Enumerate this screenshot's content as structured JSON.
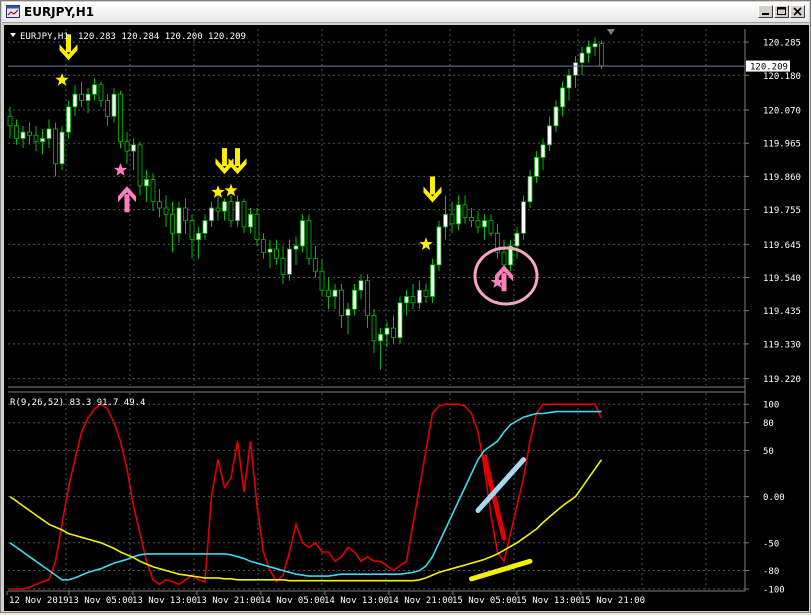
{
  "window": {
    "title": "EURJPY,H1"
  },
  "price_pane": {
    "header_symbol": "EURJPY,H1",
    "header_ohlc": "120.283 120.284 120.200 120.209",
    "current_price_label": "120.209",
    "y_ticks": [
      "120.285",
      "120.180",
      "120.070",
      "119.965",
      "119.860",
      "119.755",
      "119.645",
      "119.540",
      "119.435",
      "119.330",
      "119.220"
    ]
  },
  "indicator_pane": {
    "header": "R(9,26,52) 83.3 91.7 49.4",
    "y_ticks": [
      "100",
      "80",
      "50",
      "0.00",
      "-50",
      "-80",
      "-100"
    ]
  },
  "x_ticks": [
    "12 Nov 2019",
    "13 Nov 05:00",
    "13 Nov 13:00",
    "13 Nov 21:00",
    "14 Nov 05:00",
    "14 Nov 13:00",
    "14 Nov 21:00",
    "15 Nov 05:00",
    "15 Nov 13:00",
    "15 Nov 21:00"
  ],
  "colors": {
    "background": "#000000",
    "grid": "#4a5a5a",
    "bull_candle": "#ffffff",
    "bear_candle": "#000000",
    "candle_wick": "#00c000",
    "signal_yellow": "#ffee00",
    "signal_pink": "#ff7fbf",
    "line_red": "#e00000",
    "line_cyan": "#40d8f0",
    "line_yellow": "#f0f000"
  },
  "chart_data": [
    {
      "type": "candlestick",
      "ylim": [
        119.2,
        120.32
      ],
      "candles": [
        [
          120.05,
          120.08,
          119.98,
          120.02
        ],
        [
          120.02,
          120.04,
          119.96,
          119.98
        ],
        [
          119.98,
          120.02,
          119.95,
          120.0
        ],
        [
          120.0,
          120.03,
          119.96,
          119.99
        ],
        [
          119.99,
          120.02,
          119.94,
          119.97
        ],
        [
          119.97,
          120.01,
          119.93,
          119.98
        ],
        [
          119.98,
          120.04,
          119.95,
          120.01
        ],
        [
          120.01,
          120.03,
          119.86,
          119.9
        ],
        [
          119.9,
          120.02,
          119.88,
          120.0
        ],
        [
          120.0,
          120.1,
          119.98,
          120.08
        ],
        [
          120.08,
          120.15,
          120.05,
          120.12
        ],
        [
          120.12,
          120.16,
          120.08,
          120.1
        ],
        [
          120.1,
          120.14,
          120.06,
          120.12
        ],
        [
          120.12,
          120.17,
          120.1,
          120.15
        ],
        [
          120.15,
          120.16,
          120.08,
          120.1
        ],
        [
          120.1,
          120.12,
          120.02,
          120.05
        ],
        [
          120.05,
          120.14,
          120.03,
          120.12
        ],
        [
          120.12,
          120.13,
          119.95,
          119.97
        ],
        [
          119.97,
          120.0,
          119.9,
          119.94
        ],
        [
          119.94,
          119.98,
          119.88,
          119.96
        ],
        [
          119.96,
          119.97,
          119.8,
          119.83
        ],
        [
          119.83,
          119.88,
          119.78,
          119.85
        ],
        [
          119.85,
          119.87,
          119.75,
          119.78
        ],
        [
          119.78,
          119.82,
          119.73,
          119.76
        ],
        [
          119.76,
          119.8,
          119.7,
          119.74
        ],
        [
          119.74,
          119.78,
          119.62,
          119.68
        ],
        [
          119.68,
          119.78,
          119.65,
          119.76
        ],
        [
          119.76,
          119.79,
          119.68,
          119.72
        ],
        [
          119.72,
          119.74,
          119.6,
          119.66
        ],
        [
          119.66,
          119.7,
          119.6,
          119.68
        ],
        [
          119.68,
          119.74,
          119.66,
          119.72
        ],
        [
          119.72,
          119.78,
          119.7,
          119.76
        ],
        [
          119.76,
          119.8,
          119.72,
          119.75
        ],
        [
          119.75,
          119.79,
          119.72,
          119.78
        ],
        [
          119.78,
          119.8,
          119.7,
          119.72
        ],
        [
          119.72,
          119.8,
          119.7,
          119.78
        ],
        [
          119.78,
          119.79,
          119.68,
          119.7
        ],
        [
          119.7,
          119.76,
          119.68,
          119.74
        ],
        [
          119.74,
          119.76,
          119.64,
          119.66
        ],
        [
          119.66,
          119.68,
          119.6,
          119.62
        ],
        [
          119.62,
          119.66,
          119.57,
          119.63
        ],
        [
          119.63,
          119.66,
          119.58,
          119.6
        ],
        [
          119.6,
          119.64,
          119.52,
          119.55
        ],
        [
          119.55,
          119.66,
          119.53,
          119.63
        ],
        [
          119.63,
          119.67,
          119.58,
          119.64
        ],
        [
          119.64,
          119.74,
          119.62,
          119.72
        ],
        [
          119.72,
          119.74,
          119.58,
          119.6
        ],
        [
          119.6,
          119.64,
          119.54,
          119.56
        ],
        [
          119.56,
          119.6,
          119.48,
          119.5
        ],
        [
          119.5,
          119.54,
          119.44,
          119.48
        ],
        [
          119.48,
          119.52,
          119.44,
          119.5
        ],
        [
          119.5,
          119.52,
          119.38,
          119.42
        ],
        [
          119.42,
          119.46,
          119.36,
          119.44
        ],
        [
          119.44,
          119.52,
          119.42,
          119.5
        ],
        [
          119.5,
          119.55,
          119.47,
          119.53
        ],
        [
          119.53,
          119.55,
          119.38,
          119.42
        ],
        [
          119.42,
          119.44,
          119.3,
          119.34
        ],
        [
          119.34,
          119.38,
          119.25,
          119.36
        ],
        [
          119.36,
          119.4,
          119.32,
          119.38
        ],
        [
          119.38,
          119.42,
          119.33,
          119.35
        ],
        [
          119.35,
          119.48,
          119.33,
          119.46
        ],
        [
          119.46,
          119.5,
          119.42,
          119.48
        ],
        [
          119.48,
          119.52,
          119.44,
          119.46
        ],
        [
          119.46,
          119.53,
          119.44,
          119.5
        ],
        [
          119.5,
          119.52,
          119.46,
          119.48
        ],
        [
          119.48,
          119.6,
          119.46,
          119.58
        ],
        [
          119.58,
          119.72,
          119.56,
          119.7
        ],
        [
          119.7,
          119.8,
          119.66,
          119.74
        ],
        [
          119.74,
          119.78,
          119.68,
          119.71
        ],
        [
          119.71,
          119.8,
          119.69,
          119.77
        ],
        [
          119.77,
          119.8,
          119.71,
          119.73
        ],
        [
          119.73,
          119.76,
          119.7,
          119.72
        ],
        [
          119.72,
          119.75,
          119.68,
          119.7
        ],
        [
          119.7,
          119.74,
          119.66,
          119.72
        ],
        [
          119.72,
          119.74,
          119.67,
          119.68
        ],
        [
          119.68,
          119.71,
          119.6,
          119.62
        ],
        [
          119.62,
          119.66,
          119.54,
          119.58
        ],
        [
          119.58,
          119.66,
          119.56,
          119.64
        ],
        [
          119.64,
          119.7,
          119.6,
          119.68
        ],
        [
          119.68,
          119.8,
          119.66,
          119.78
        ],
        [
          119.78,
          119.88,
          119.76,
          119.86
        ],
        [
          119.86,
          119.94,
          119.84,
          119.92
        ],
        [
          119.92,
          119.98,
          119.88,
          119.96
        ],
        [
          119.96,
          120.05,
          119.94,
          120.02
        ],
        [
          120.02,
          120.1,
          120.0,
          120.08
        ],
        [
          120.08,
          120.16,
          120.05,
          120.14
        ],
        [
          120.14,
          120.2,
          120.1,
          120.18
        ],
        [
          120.18,
          120.24,
          120.14,
          120.22
        ],
        [
          120.22,
          120.27,
          120.18,
          120.25
        ],
        [
          120.25,
          120.29,
          120.22,
          120.27
        ],
        [
          120.27,
          120.3,
          120.24,
          120.28
        ],
        [
          120.28,
          120.29,
          120.2,
          120.21
        ]
      ],
      "signals": [
        {
          "kind": "arrow-down",
          "color": "yellow",
          "index": 9,
          "price": 120.24
        },
        {
          "kind": "star",
          "color": "yellow",
          "index": 8,
          "price": 120.165
        },
        {
          "kind": "star",
          "color": "pink",
          "index": 17,
          "price": 119.88
        },
        {
          "kind": "arrow-up",
          "color": "pink",
          "index": 18,
          "price": 119.81
        },
        {
          "kind": "arrow-down",
          "color": "yellow",
          "index": 33,
          "price": 119.88
        },
        {
          "kind": "arrow-down",
          "color": "yellow",
          "index": 35,
          "price": 119.88
        },
        {
          "kind": "star",
          "color": "yellow",
          "index": 32,
          "price": 119.81
        },
        {
          "kind": "star",
          "color": "yellow",
          "index": 34,
          "price": 119.815
        },
        {
          "kind": "arrow-down",
          "color": "yellow",
          "index": 65,
          "price": 119.79
        },
        {
          "kind": "star",
          "color": "yellow",
          "index": 64,
          "price": 119.645
        },
        {
          "kind": "star",
          "color": "pink",
          "index": 75,
          "price": 119.525
        },
        {
          "kind": "arrow-up",
          "color": "pink",
          "index": 76,
          "price": 119.56
        }
      ],
      "circle_highlight": {
        "index": 76,
        "price": 119.545
      }
    },
    {
      "type": "line",
      "ylim": [
        -100,
        110
      ],
      "series": [
        {
          "color": "red",
          "values": [
            -100,
            -100,
            -100,
            -98,
            -95,
            -92,
            -90,
            -70,
            -30,
            10,
            40,
            70,
            85,
            95,
            100,
            95,
            80,
            60,
            30,
            -10,
            -40,
            -70,
            -90,
            -95,
            -90,
            -92,
            -95,
            -90,
            -85,
            -90,
            -92,
            0,
            40,
            10,
            20,
            60,
            5,
            60,
            -10,
            -60,
            -80,
            -92,
            -85,
            -60,
            -30,
            -50,
            -55,
            -50,
            -60,
            -60,
            -70,
            -65,
            -55,
            -60,
            -70,
            -65,
            -70,
            -70,
            -75,
            -80,
            -75,
            -70,
            -30,
            10,
            50,
            90,
            98,
            100,
            100,
            100,
            98,
            90,
            70,
            30,
            -20,
            -60,
            -70,
            -40,
            -10,
            20,
            60,
            90,
            100,
            100,
            100,
            100,
            100,
            100,
            100,
            100,
            100,
            85
          ]
        },
        {
          "color": "cyan",
          "values": [
            -50,
            -55,
            -60,
            -65,
            -70,
            -75,
            -80,
            -85,
            -90,
            -90,
            -88,
            -85,
            -82,
            -80,
            -78,
            -75,
            -72,
            -70,
            -68,
            -65,
            -63,
            -62,
            -62,
            -62,
            -62,
            -62,
            -62,
            -62,
            -62,
            -62,
            -62,
            -62,
            -62,
            -62,
            -63,
            -65,
            -67,
            -70,
            -72,
            -74,
            -76,
            -78,
            -80,
            -82,
            -84,
            -85,
            -86,
            -86,
            -86,
            -86,
            -85,
            -84,
            -84,
            -84,
            -84,
            -84,
            -84,
            -84,
            -84,
            -84,
            -84,
            -83,
            -82,
            -80,
            -75,
            -65,
            -50,
            -35,
            -20,
            -5,
            10,
            25,
            40,
            50,
            55,
            60,
            70,
            78,
            82,
            86,
            88,
            90,
            90,
            91,
            92,
            92,
            92,
            92,
            92,
            92,
            92,
            92
          ]
        },
        {
          "color": "yellow",
          "values": [
            0,
            -5,
            -10,
            -15,
            -20,
            -25,
            -30,
            -33,
            -36,
            -40,
            -42,
            -44,
            -46,
            -48,
            -50,
            -53,
            -56,
            -60,
            -63,
            -66,
            -70,
            -73,
            -76,
            -78,
            -80,
            -82,
            -84,
            -85,
            -86,
            -87,
            -88,
            -88,
            -88,
            -89,
            -89,
            -90,
            -90,
            -90,
            -90,
            -90,
            -90,
            -90,
            -90,
            -91,
            -91,
            -91,
            -91,
            -91,
            -91,
            -91,
            -91,
            -91,
            -91,
            -91,
            -91,
            -91,
            -91,
            -91,
            -91,
            -91,
            -91,
            -91,
            -91,
            -90,
            -88,
            -85,
            -82,
            -80,
            -78,
            -76,
            -74,
            -72,
            -70,
            -68,
            -65,
            -62,
            -58,
            -54,
            -50,
            -45,
            -40,
            -35,
            -28,
            -22,
            -16,
            -10,
            -5,
            0,
            10,
            20,
            30,
            40
          ]
        }
      ],
      "annotations": [
        {
          "kind": "line",
          "color": "red",
          "from": [
            73,
            43
          ],
          "to": [
            76,
            -45
          ]
        },
        {
          "kind": "line",
          "color": "lightblue",
          "from": [
            72,
            -15
          ],
          "to": [
            79,
            40
          ]
        },
        {
          "kind": "line",
          "color": "yellow",
          "from": [
            71,
            -89
          ],
          "to": [
            80,
            -70
          ]
        }
      ]
    }
  ]
}
